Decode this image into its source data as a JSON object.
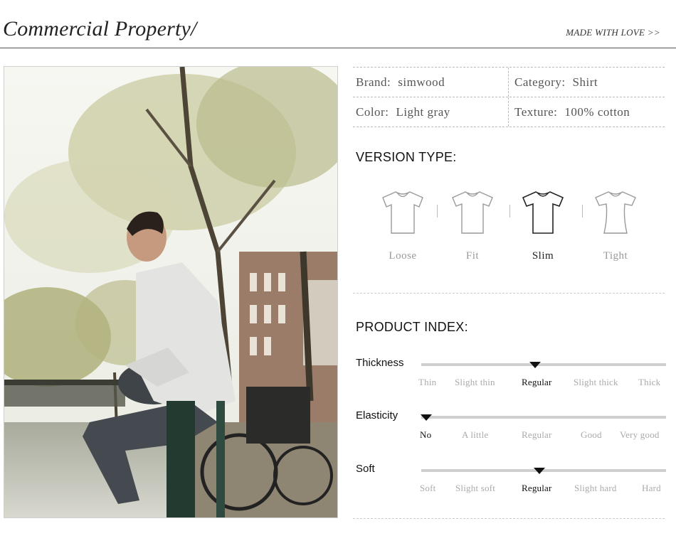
{
  "header": {
    "title": "Commercial Property/",
    "link": "MADE WITH LOVE >>"
  },
  "specs": {
    "brand": {
      "label": "Brand:",
      "value": "simwood"
    },
    "category": {
      "label": "Category:",
      "value": "Shirt"
    },
    "color": {
      "label": "Color:",
      "value": "Light gray"
    },
    "texture": {
      "label": "Texture:",
      "value": "100% cotton"
    }
  },
  "version_type": {
    "title": "VERSION TYPE:",
    "options": [
      "Loose",
      "Fit",
      "Slim",
      "Tight"
    ],
    "selected": "Slim"
  },
  "product_index": {
    "title": "PRODUCT INDEX:",
    "rows": [
      {
        "name": "Thickness",
        "ticks": [
          "Thin",
          "Slight thin",
          "Regular",
          "Slight thick",
          "Thick"
        ],
        "selected": "Regular"
      },
      {
        "name": "Elasticity",
        "ticks": [
          "No",
          "A little",
          "Regular",
          "Good",
          "Very good"
        ],
        "selected": "No"
      },
      {
        "name": "Soft",
        "ticks": [
          "Soft",
          "Slight soft",
          "Regular",
          "Slight hard",
          "Hard"
        ],
        "selected": "Regular"
      }
    ]
  }
}
